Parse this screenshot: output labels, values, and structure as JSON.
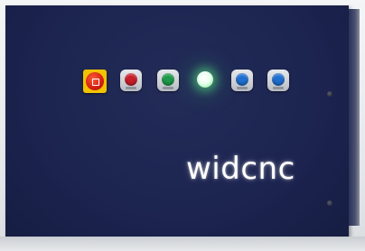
{
  "brand": {
    "text": "widcnc"
  },
  "controls": {
    "emergency_stop": {
      "color": "#d21f12",
      "frame_color": "#f2c400",
      "icon": "emergency-stop-icon"
    },
    "buttons": [
      {
        "id": "red",
        "color": "#c81e2a"
      },
      {
        "id": "green",
        "color": "#1f9a4a"
      },
      {
        "id": "blue-1",
        "color": "#1f6fd1"
      },
      {
        "id": "blue-2",
        "color": "#1f6fd1"
      }
    ],
    "indicator_lamp": {
      "color": "#55e07f",
      "state": "on"
    }
  },
  "colors": {
    "panel": "#1c2450",
    "wall": "#e9ecef"
  }
}
